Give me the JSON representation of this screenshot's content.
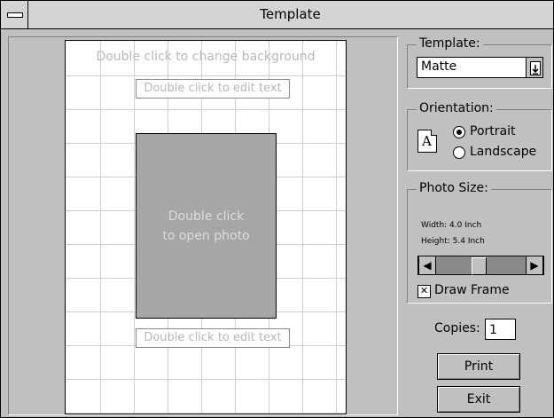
{
  "window": {
    "title": "Template"
  },
  "canvas": {
    "background_hint": "Double click to change background",
    "top_text_placeholder": "Double click to edit text",
    "photo_placeholder_line1": "Double click",
    "photo_placeholder_line2": "to open photo",
    "bottom_text_placeholder": "Double click to edit text"
  },
  "template": {
    "group_label": "Template:",
    "selected": "Matte"
  },
  "orientation": {
    "group_label": "Orientation:",
    "icon_letter": "A",
    "options": [
      "Portrait",
      "Landscape"
    ],
    "selected": "Portrait"
  },
  "photo_size": {
    "group_label": "Photo Size:",
    "width_text": "Width: 4.0 Inch",
    "height_text": "Height: 5.4 Inch",
    "scroll_left_icon": "left-arrow-icon",
    "scroll_right_icon": "right-arrow-icon",
    "draw_frame_label": "Draw Frame",
    "draw_frame_checked": true
  },
  "copies": {
    "label": "Copies:",
    "value": "1"
  },
  "buttons": {
    "print": "Print",
    "exit": "Exit"
  }
}
